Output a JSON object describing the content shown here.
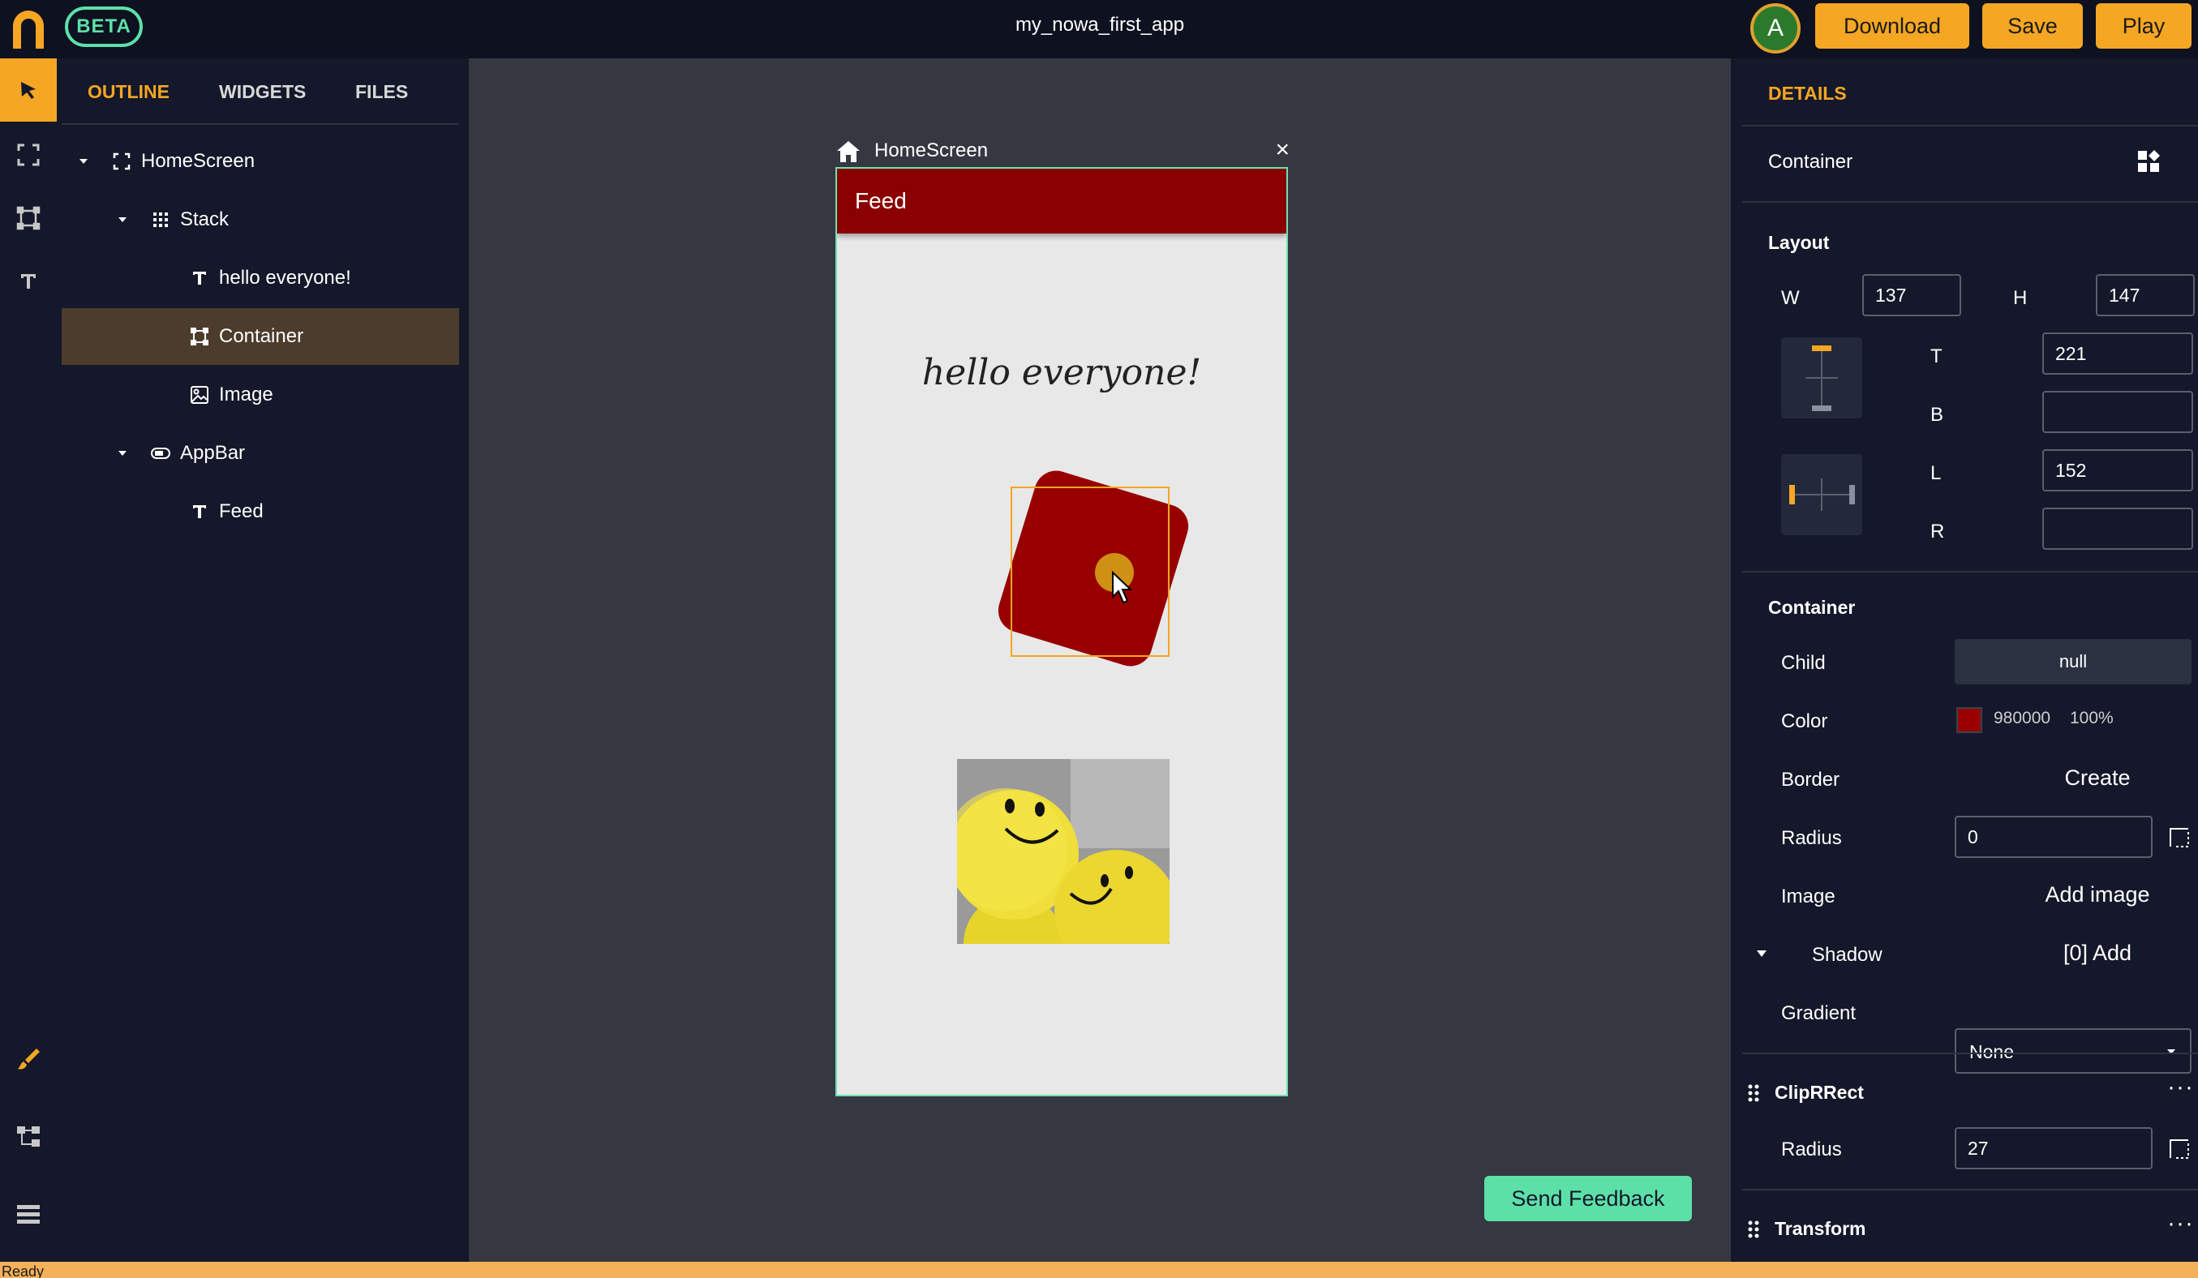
{
  "topbar": {
    "beta_label": "BETA",
    "app_title": "my_nowa_first_app",
    "avatar_initial": "A",
    "download_label": "Download",
    "save_label": "Save",
    "play_label": "Play"
  },
  "left_tabs": {
    "outline": "OUTLINE",
    "widgets": "WIDGETS",
    "files": "FILES"
  },
  "outline_tree": [
    {
      "label": "HomeScreen",
      "icon": "fullscreen-icon",
      "expanded": true
    },
    {
      "label": "Stack",
      "icon": "grid-icon",
      "expanded": true
    },
    {
      "label": "hello everyone!",
      "icon": "text-icon"
    },
    {
      "label": "Container",
      "icon": "container-icon",
      "selected": true
    },
    {
      "label": "Image",
      "icon": "image-icon"
    },
    {
      "label": "AppBar",
      "icon": "appbar-icon",
      "expanded": true
    },
    {
      "label": "Feed",
      "icon": "text-icon"
    }
  ],
  "canvas": {
    "screen_name": "HomeScreen",
    "appbar_title": "Feed",
    "hello_text": "hello everyone!",
    "container_color": "#980000",
    "appbar_color": "#8b0000"
  },
  "feedback_label": "Send Feedback",
  "details": {
    "header": "DETAILS",
    "widget_name": "Container",
    "layout": {
      "title": "Layout",
      "w_label": "W",
      "w_value": "137",
      "h_label": "H",
      "h_value": "147",
      "t_label": "T",
      "t_value": "221",
      "b_label": "B",
      "b_value": "",
      "l_label": "L",
      "l_value": "152",
      "r_label": "R",
      "r_value": ""
    },
    "container": {
      "title": "Container",
      "child_label": "Child",
      "child_value": "null",
      "color_label": "Color",
      "color_hex": "980000",
      "color_opacity": "100%",
      "border_label": "Border",
      "border_action": "Create",
      "radius_label": "Radius",
      "radius_value": "0",
      "image_label": "Image",
      "image_action": "Add image",
      "shadow_label": "Shadow",
      "shadow_action": "[0] Add",
      "gradient_label": "Gradient",
      "gradient_value": "None"
    },
    "cliprrect": {
      "title": "ClipRRect",
      "radius_label": "Radius",
      "radius_value": "27"
    },
    "transform": {
      "title": "Transform"
    }
  },
  "status": "Ready",
  "accent_color": "#f5a623",
  "beta_color": "#5de0a8"
}
